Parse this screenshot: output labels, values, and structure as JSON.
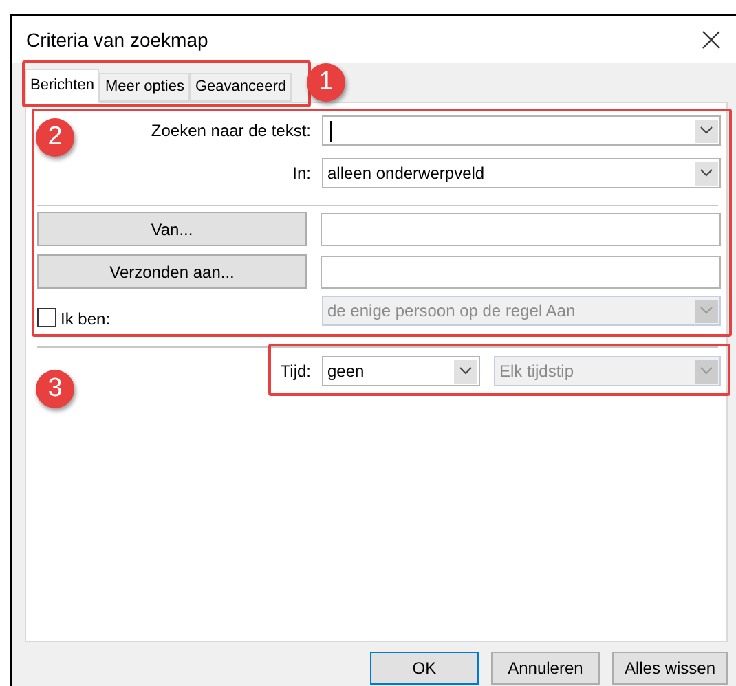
{
  "dialog": {
    "title": "Criteria van zoekmap"
  },
  "tabs": [
    {
      "label": "Berichten",
      "selected": true
    },
    {
      "label": "Meer opties",
      "selected": false
    },
    {
      "label": "Geavanceerd",
      "selected": false
    }
  ],
  "search_text": {
    "label": "Zoeken naar de tekst:"
  },
  "search_in": {
    "label": "In:",
    "value": "alleen onderwerpveld"
  },
  "address_rows": [
    {
      "button": "Van..."
    },
    {
      "button": "Verzonden aan..."
    }
  ],
  "i_am": {
    "label": "Ik ben:",
    "checked": false,
    "value": "de enige persoon op de regel Aan",
    "disabled": true
  },
  "time": {
    "label": "Tijd:",
    "value": "geen",
    "disabled": false,
    "range": {
      "value": "Elk tijdstip",
      "disabled": true
    }
  },
  "buttons": [
    {
      "label": "OK",
      "default": true
    },
    {
      "label": "Annuleren",
      "default": false
    },
    {
      "label": "Alles wissen",
      "default": false
    }
  ],
  "callouts": [
    {
      "label": "1"
    },
    {
      "label": "2"
    },
    {
      "label": "3"
    }
  ]
}
